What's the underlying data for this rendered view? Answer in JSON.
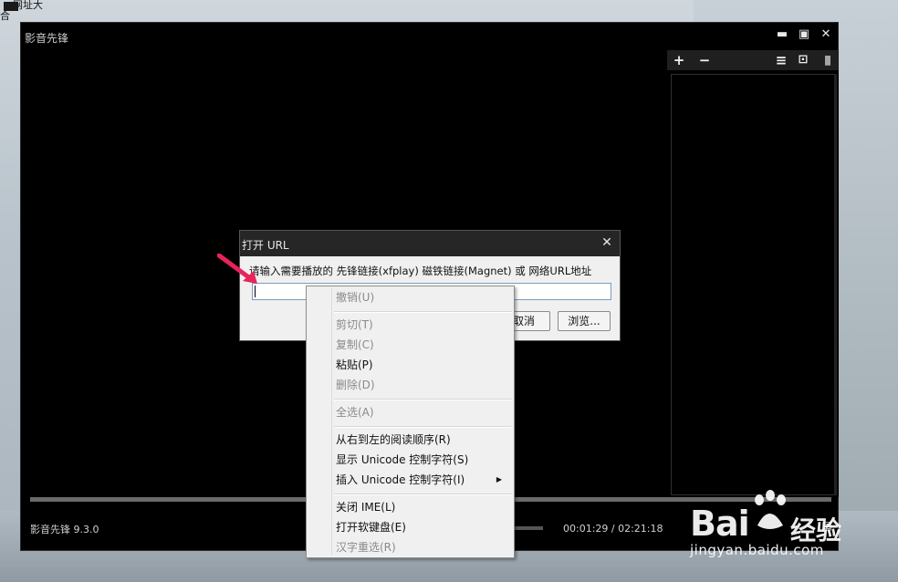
{
  "desktop": {
    "line1": "网址大",
    "line2": "合"
  },
  "player": {
    "title": "影音先锋",
    "version": "影音先锋 9.3.0",
    "time": "00:01:29 / 02:21:18",
    "window_buttons": {
      "minimize": "▬",
      "maximize": "▣",
      "close": "✕"
    },
    "playlist_buttons": {
      "add": "+",
      "remove": "−",
      "menu": "≡",
      "screen": "⊡",
      "signal": "|||"
    }
  },
  "dialog": {
    "title": "打开 URL",
    "close": "✕",
    "prompt": "请输入需要播放的 先锋链接(xfplay) 磁铁链接(Magnet) 或 网络URL地址",
    "input_value": "",
    "cancel_label": "取消",
    "browse_label": "浏览..."
  },
  "context_menu": {
    "items": [
      {
        "label": "撤销(U)",
        "enabled": false
      },
      {
        "label": "剪切(T)",
        "enabled": false
      },
      {
        "label": "复制(C)",
        "enabled": false
      },
      {
        "label": "粘贴(P)",
        "enabled": true
      },
      {
        "label": "删除(D)",
        "enabled": false
      },
      {
        "label": "全选(A)",
        "enabled": false
      },
      {
        "label": "从右到左的阅读顺序(R)",
        "enabled": true
      },
      {
        "label": "显示 Unicode 控制字符(S)",
        "enabled": true
      },
      {
        "label": "插入 Unicode 控制字符(I)",
        "enabled": true,
        "submenu_arrow": "▶"
      },
      {
        "label": "关闭 IME(L)",
        "enabled": true
      },
      {
        "label": "打开软键盘(E)",
        "enabled": true
      },
      {
        "label": "汉字重选(R)",
        "enabled": false
      }
    ]
  },
  "watermark": {
    "brand": "Bai",
    "cn": "经验",
    "url": "jingyan.baidu.com"
  },
  "colors": {
    "accent_arrow": "#e8245a",
    "player_bg": "#000000",
    "dialog_bg": "#f0f0f0"
  }
}
